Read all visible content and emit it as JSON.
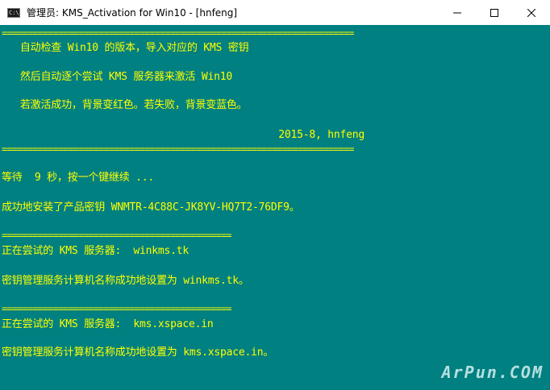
{
  "window": {
    "icon_text": "C:\\",
    "title": "管理员:  KMS_Activation for Win10 - [hnfeng]",
    "background": "#008080",
    "text_color": "#ffff00"
  },
  "controls": {
    "minimize_icon": "minimize-icon",
    "maximize_icon": "maximize-icon",
    "close_icon": "close-icon"
  },
  "console": {
    "sep_long": "=====================================================================",
    "sep_short": "=============================================",
    "intro1": "   自动检查 Win10 的版本，导入对应的 KMS 密钥",
    "intro2": "   然后自动逐个尝试 KMS 服务器来激活 Win10",
    "intro3": "   若激活成功，背景变红色。若失败，背景变蓝色。",
    "signature": "                                             2015-8, hnfeng",
    "wait": "等待  9 秒，按一个键继续 ...",
    "key_installed": "成功地安装了产品密钥 WNMTR-4C88C-JK8YV-HQ7T2-76DF9。",
    "try1": "正在尝试的 KMS 服务器:  winkms.tk",
    "set1": "密钥管理服务计算机名称成功地设置为 winkms.tk。",
    "try2": "正在尝试的 KMS 服务器:  kms.xspace.in",
    "set2": "密钥管理服务计算机名称成功地设置为 kms.xspace.in。"
  },
  "watermark": "ArPun.COM"
}
